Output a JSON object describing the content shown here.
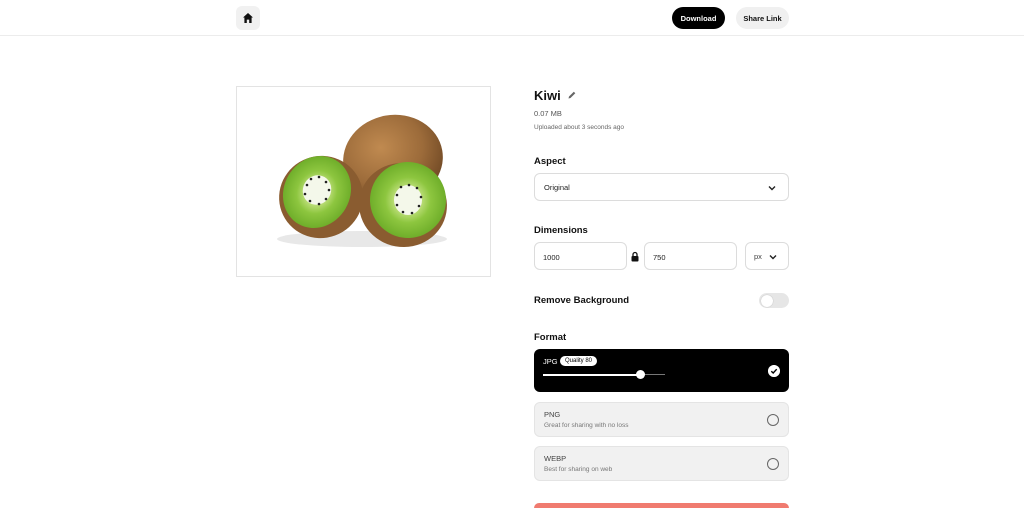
{
  "header": {
    "home_icon": "home-icon",
    "download_label": "Download",
    "share_label": "Share Link"
  },
  "file": {
    "name": "Kiwi",
    "size": "0.07 MB",
    "uploaded": "Uploaded about 3 seconds ago"
  },
  "aspect": {
    "label": "Aspect",
    "value": "Original"
  },
  "dimensions": {
    "label": "Dimensions",
    "width": "1000",
    "height": "750",
    "unit": "px"
  },
  "remove_background": {
    "label": "Remove Background",
    "enabled": false
  },
  "format": {
    "label": "Format",
    "options": [
      {
        "name": "JPG",
        "quality_label": "Quality 80",
        "quality": 80,
        "selected": true
      },
      {
        "name": "PNG",
        "description": "Great for sharing with no loss",
        "selected": false
      },
      {
        "name": "WEBP",
        "description": "Best for sharing on web",
        "selected": false
      }
    ]
  },
  "colors": {
    "primary": "#000000",
    "accent_bottom": "#f07b70",
    "kiwi_flesh": "#8dc63f",
    "kiwi_skin": "#9c6b3a"
  }
}
